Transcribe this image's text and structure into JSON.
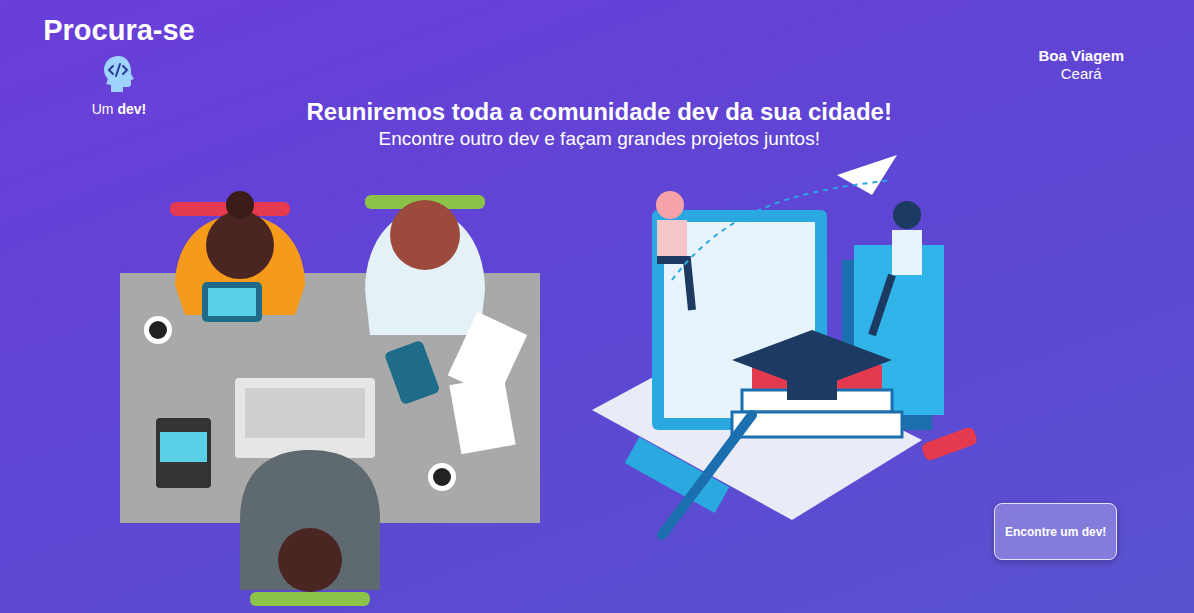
{
  "brand": {
    "title": "Procura-se",
    "tagline_prefix": "Um",
    "tagline_bold": "dev!"
  },
  "location": {
    "city": "Boa Viagem",
    "state": "Ceará"
  },
  "hero": {
    "headline": "Reuniremos toda a comunidade dev da sua cidade!",
    "subheadline": "Encontre outro dev e façam grandes projetos juntos!"
  },
  "cta": {
    "label": "Encontre um dev!"
  }
}
